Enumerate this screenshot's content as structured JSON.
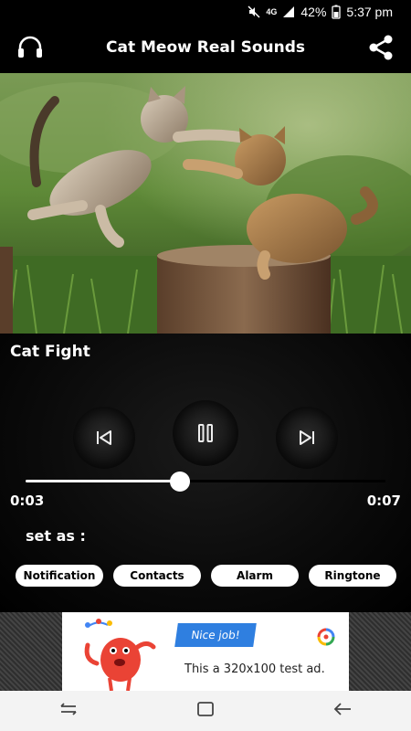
{
  "status_bar": {
    "network": "4G",
    "battery": "42%",
    "time": "5:37 pm"
  },
  "header": {
    "title": "Cat Meow Real Sounds",
    "left_icon": "headphones-icon",
    "right_icon": "share-icon"
  },
  "player": {
    "track_title": "Cat Fight",
    "current_time": "0:03",
    "total_time": "0:07",
    "progress": 0.43,
    "controls": [
      "previous-icon",
      "pause-icon",
      "next-icon"
    ]
  },
  "set_as": {
    "label": "set as :",
    "options": [
      "Notification",
      "Contacts",
      "Alarm",
      "Ringtone"
    ]
  },
  "ad": {
    "badge": "Nice job!",
    "text": "This a 320x100 test ad."
  },
  "nav": {
    "icons": [
      "recent-apps-icon",
      "home-icon",
      "back-icon"
    ]
  },
  "colors": {
    "background": "#000000",
    "accent": "#ffffff",
    "ad_badge": "#2f7fe0"
  }
}
